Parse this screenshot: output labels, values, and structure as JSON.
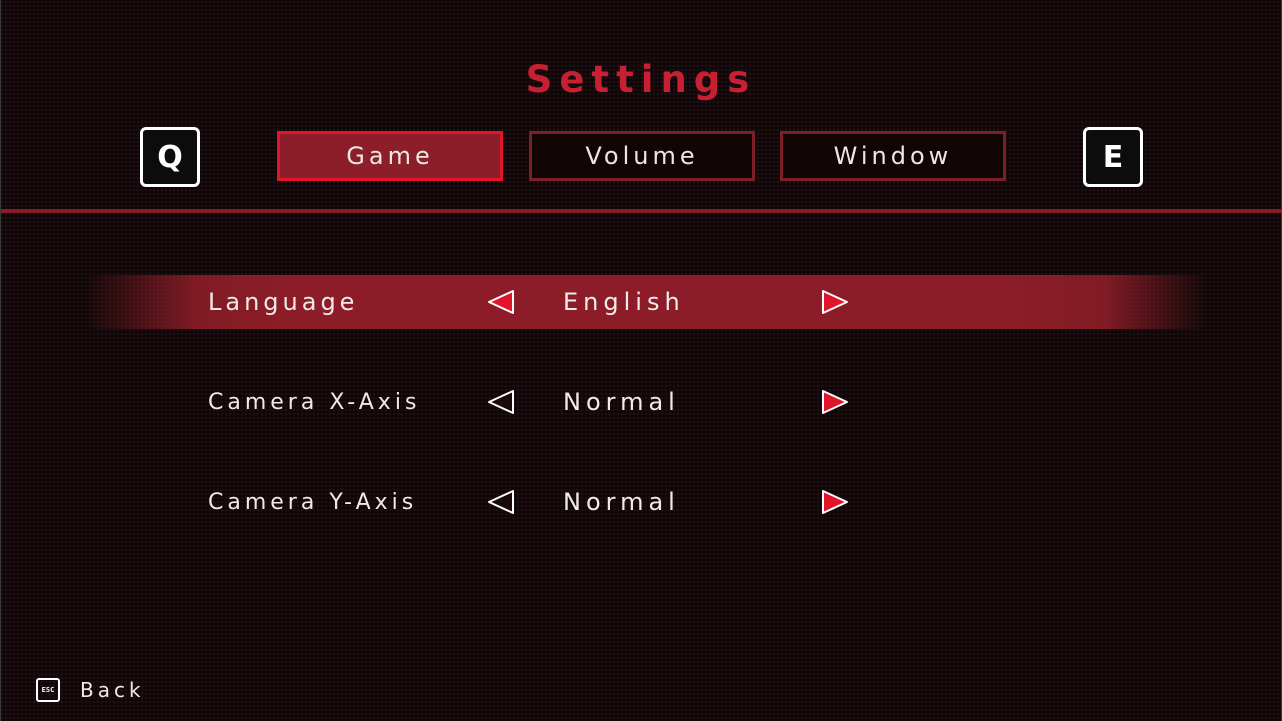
{
  "title": "Settings",
  "keys": {
    "prev": "Q",
    "next": "E"
  },
  "tabs": [
    {
      "label": "Game",
      "active": true
    },
    {
      "label": "Volume",
      "active": false
    },
    {
      "label": "Window",
      "active": false
    }
  ],
  "settings": [
    {
      "label": "Language",
      "value": "English",
      "selected": true
    },
    {
      "label": "Camera X-Axis",
      "value": "Normal",
      "selected": false
    },
    {
      "label": "Camera Y-Axis",
      "value": "Normal",
      "selected": false
    }
  ],
  "footer": {
    "key_label": "ESC",
    "back_label": "Back"
  },
  "icons": {
    "left_arrow": "triangle-left-icon",
    "right_arrow": "triangle-right-icon"
  },
  "colors": {
    "accent": "#c81f33",
    "active_tab_fill": "#8b1e28",
    "active_tab_border": "#e4152a",
    "tab_border": "#7e1f28",
    "row_highlight": "#8c1d28",
    "arrow_red": "#e0142a",
    "background": "#150809"
  }
}
